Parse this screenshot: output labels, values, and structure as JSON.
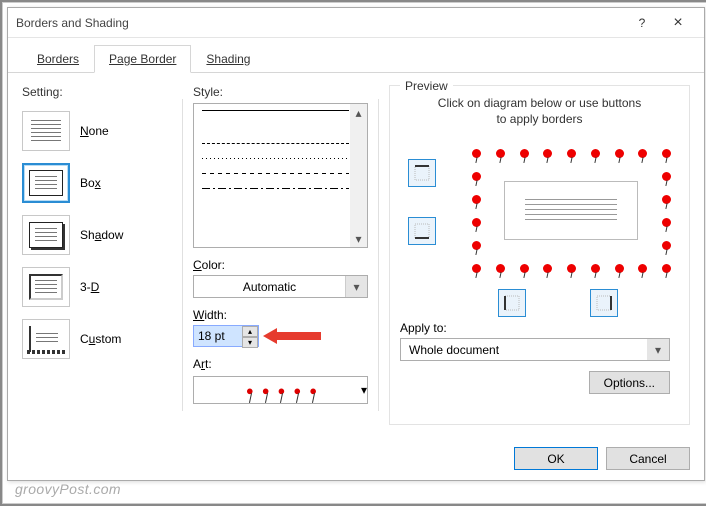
{
  "titlebar": {
    "title": "Borders and Shading",
    "help": "?",
    "close": "×"
  },
  "tabs": {
    "borders": "Borders",
    "page_border": "Page Border",
    "shading": "Shading",
    "active": "page_border"
  },
  "setting": {
    "label": "Setting:",
    "items": [
      {
        "label": "None",
        "accel": "N",
        "selected": false
      },
      {
        "label": "Box",
        "accel": "x",
        "selected": true
      },
      {
        "label": "Shadow",
        "accel": "A",
        "selected": false
      },
      {
        "label": "3-D",
        "accel": "D",
        "selected": false
      },
      {
        "label": "Custom",
        "accel": "U",
        "selected": false
      }
    ]
  },
  "style": {
    "label": "Style:",
    "color_label": "Color:",
    "color_value": "Automatic",
    "width_label": "Width:",
    "width_value": "18 pt",
    "art_label": "Art:"
  },
  "preview": {
    "legend": "Preview",
    "hint1": "Click on diagram below or use buttons",
    "hint2": "to apply borders",
    "apply_label": "Apply to:",
    "apply_value": "Whole document",
    "options": "Options..."
  },
  "footer": {
    "ok": "OK",
    "cancel": "Cancel"
  },
  "watermark": "groovyPost.com"
}
